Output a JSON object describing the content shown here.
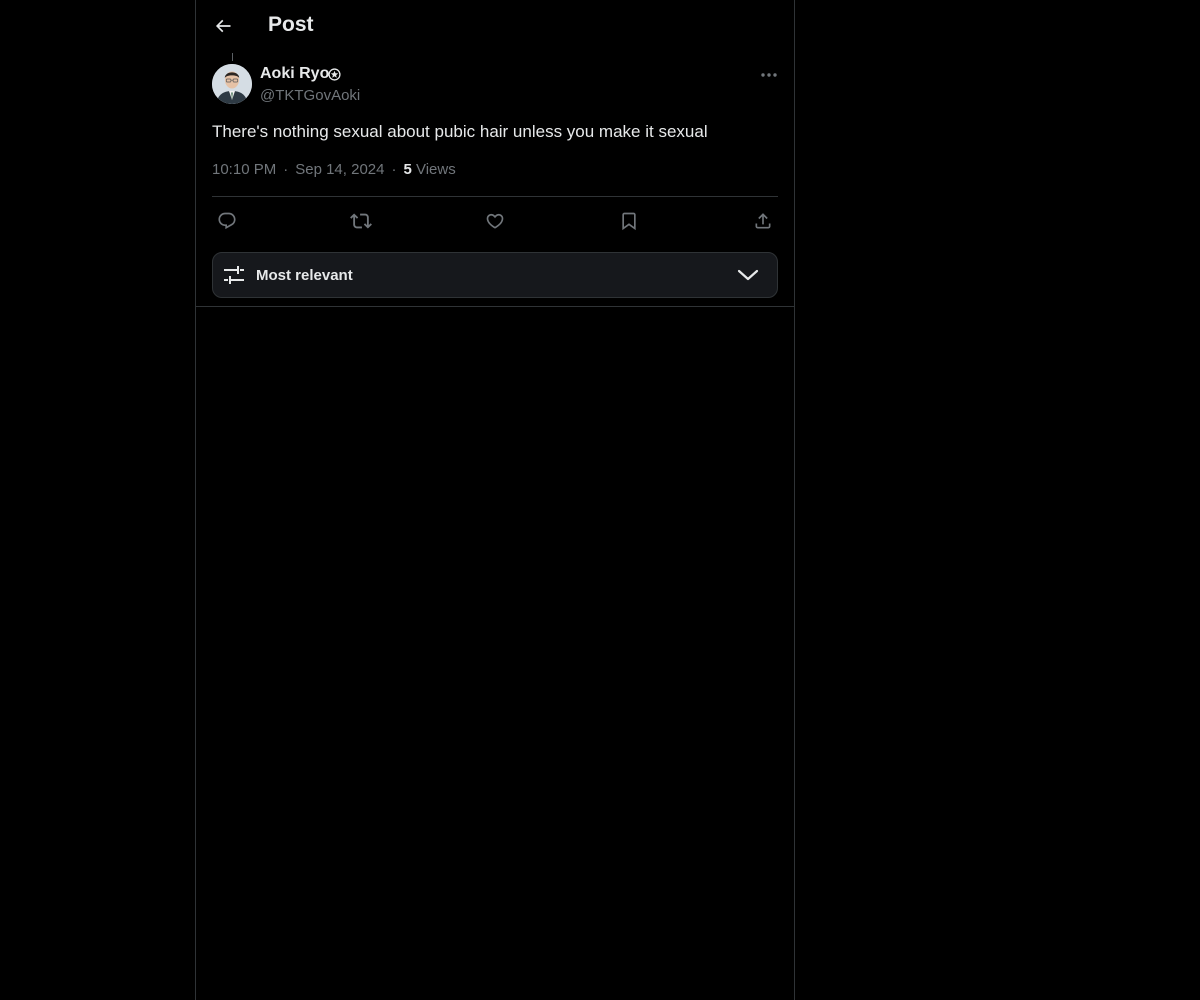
{
  "header": {
    "title": "Post",
    "back_icon": "arrow-left-icon"
  },
  "post": {
    "author_name": "Aoki Ryo",
    "author_badge_icon": "government-badge-icon",
    "author_handle": "@TKTGovAoki",
    "text": "There's nothing sexual about pubic hair unless you make it sexual",
    "time": "10:10 PM",
    "separator": "·",
    "date": "Sep 14, 2024",
    "views_count": "5",
    "views_label": "Views"
  },
  "actions": [
    {
      "icon": "reply-icon"
    },
    {
      "icon": "repost-icon"
    },
    {
      "icon": "like-icon"
    },
    {
      "icon": "bookmark-icon"
    },
    {
      "icon": "share-icon"
    }
  ],
  "sort": {
    "label": "Most relevant",
    "icon": "sliders-icon",
    "chevron": "chevron-down-icon"
  },
  "colors": {
    "background": "#000000",
    "text_primary": "#e7e9ea",
    "text_secondary": "#71767b",
    "border": "#2f3336",
    "sort_bg": "#16181c"
  }
}
